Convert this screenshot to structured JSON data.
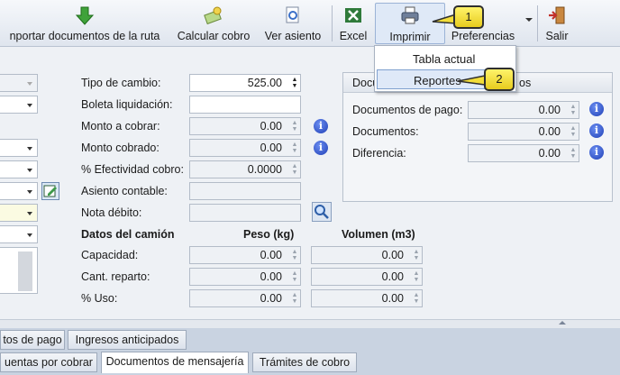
{
  "toolbar": {
    "import_label": "nportar documentos de la ruta",
    "calc_label": "Calcular cobro",
    "ver_label": "Ver asiento",
    "excel_label": "Excel",
    "print_label": "Imprimir",
    "pref_label": "Preferencias",
    "exit_label": "Salir"
  },
  "menu": {
    "items": [
      "Tabla actual",
      "Reportes"
    ],
    "selected": "Reportes"
  },
  "callouts": {
    "one": "1",
    "two": "2"
  },
  "form": {
    "tipo_cambio": {
      "label": "Tipo de cambio:",
      "value": "525.00"
    },
    "boleta": {
      "label": "Boleta liquidación:",
      "value": ""
    },
    "monto_cobrar": {
      "label": "Monto a cobrar:",
      "value": "0.00"
    },
    "monto_cobrado": {
      "label": "Monto cobrado:",
      "value": "0.00"
    },
    "efectividad": {
      "label": "% Efectividad cobro:",
      "value": "0.0000"
    },
    "asiento": {
      "label": "Asiento contable:",
      "value": ""
    },
    "nota": {
      "label": "Nota débito:",
      "value": ""
    }
  },
  "camion": {
    "title": "Datos del camión",
    "peso_header": "Peso (kg)",
    "vol_header": "Volumen (m3)",
    "rows": [
      {
        "label": "Capacidad:",
        "peso": "0.00",
        "vol": "0.00"
      },
      {
        "label": "Cant. reparto:",
        "peso": "0.00",
        "vol": "0.00"
      },
      {
        "label": "% Uso:",
        "peso": "0.00",
        "vol": "0.00"
      }
    ]
  },
  "panel": {
    "header_left": "Docu",
    "header_right": "os",
    "rows": [
      {
        "label": "Documentos de pago:",
        "value": "0.00"
      },
      {
        "label": "Documentos:",
        "value": "0.00"
      },
      {
        "label": "Diferencia:",
        "value": "0.00"
      }
    ]
  },
  "tabs_top": [
    "tos de pago",
    "Ingresos anticipados"
  ],
  "tabs_bottom": [
    "uentas por cobrar",
    "Documentos de mensajería",
    "Trámites de cobro"
  ],
  "tabs_bottom_active": "Documentos de mensajería",
  "info_glyph": "i",
  "colors": {
    "accent": "#dfe9f8",
    "callout": "#f2dd3a",
    "info": "#2a4fcf"
  }
}
